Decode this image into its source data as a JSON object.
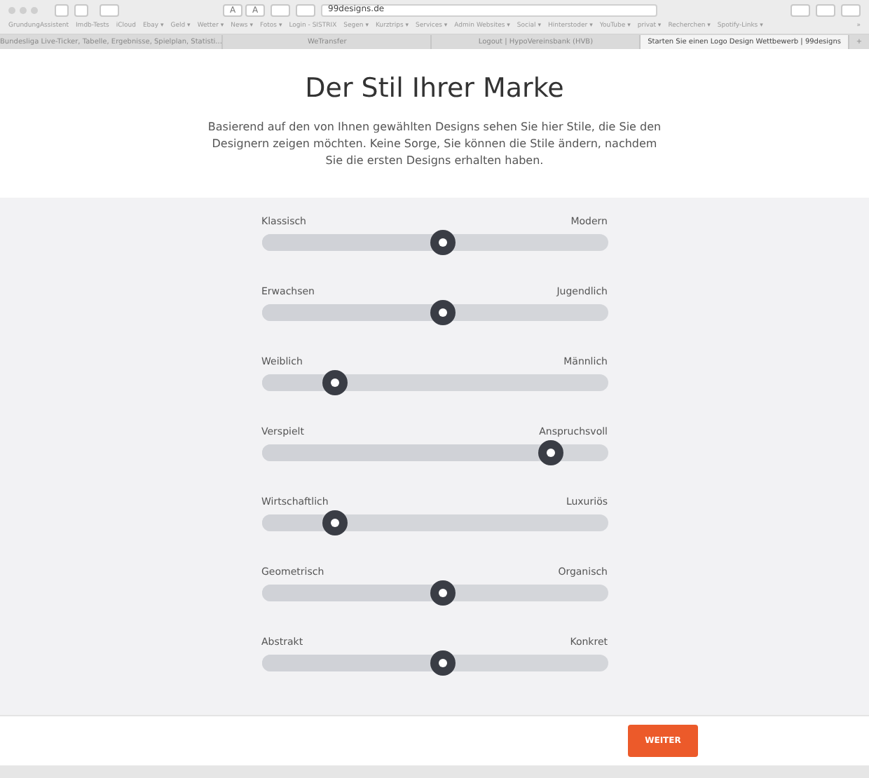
{
  "browser": {
    "url": "99designs.de",
    "reader_buttons": [
      "A",
      "A"
    ],
    "bookmarks": [
      "GrundungAssistent",
      "Imdb-Tests",
      "iCloud",
      "Ebay ▾",
      "Geld ▾",
      "Wetter ▾",
      "News ▾",
      "Fotos ▾",
      "Login - SISTRIX",
      "Segen ▾",
      "Kurztrips ▾",
      "Services ▾",
      "Admin Websites ▾",
      "Social ▾",
      "Hinterstoder ▾",
      "YouTube ▾",
      "privat ▾",
      "Recherchen ▾",
      "Spotify-Links ▾"
    ],
    "more": "»",
    "tabs": [
      {
        "title": "Bundesliga Live-Ticker, Tabelle, Ergebnisse, Spielplan, Statisti...",
        "selected": false
      },
      {
        "title": "WeTransfer",
        "selected": false
      },
      {
        "title": "Logout | HypoVereinsbank (HVB)",
        "selected": false
      },
      {
        "title": "Starten Sie einen Logo Design Wettbewerb | 99designs",
        "selected": true
      }
    ],
    "new_tab": "+"
  },
  "heading": "Der Stil Ihrer Marke",
  "intro": "Basierend auf den von Ihnen gewählten Designs sehen Sie hier Stile, die Sie den Designern zeigen möchten. Keine Sorge, Sie können die Stile ändern, nachdem Sie die ersten Designs erhalten haben.",
  "sliders": [
    {
      "left": "Klassisch",
      "right": "Modern",
      "level": 0.5
    },
    {
      "left": "Erwachsen",
      "right": "Jugendlich",
      "level": 0.5
    },
    {
      "left": "Weiblich",
      "right": "Männlich",
      "level": 0.19
    },
    {
      "left": "Verspielt",
      "right": "Anspruchsvoll",
      "level": 0.81
    },
    {
      "left": "Wirtschaftlich",
      "right": "Luxuriös",
      "level": 0.19
    },
    {
      "left": "Geometrisch",
      "right": "Organisch",
      "level": 0.5
    },
    {
      "left": "Abstrakt",
      "right": "Konkret",
      "level": 0.5
    }
  ],
  "next_button": "WEITER"
}
